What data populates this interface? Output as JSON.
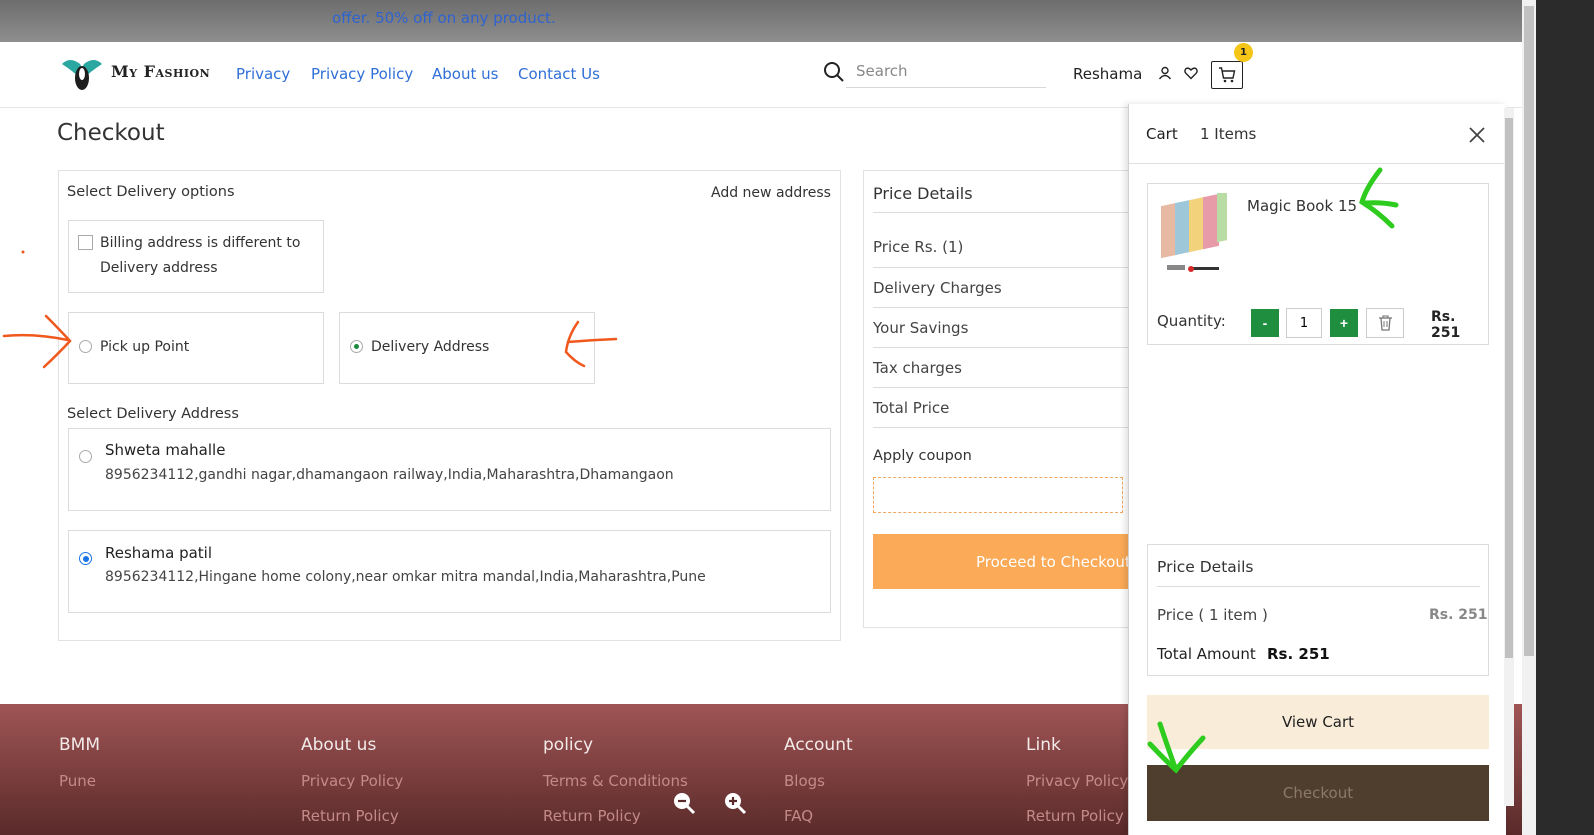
{
  "banner": {
    "text": "offer. 50% off on any product."
  },
  "header": {
    "brand": "My Fashion",
    "nav": [
      "Privacy",
      "Privacy Policy",
      "About us",
      "Contact Us"
    ],
    "search_placeholder": "Search",
    "username": "Reshama",
    "cart_count": "1"
  },
  "checkout": {
    "title": "Checkout",
    "select_delivery_options": "Select Delivery options",
    "add_new_address": "Add new address",
    "billing_line1": "Billing address is different to",
    "billing_line2": "Delivery address",
    "pickup_point": "Pick up Point",
    "delivery_address": "Delivery Address",
    "select_delivery_address": "Select Delivery Address",
    "addresses": [
      {
        "name": "Shweta mahalle",
        "detail": "8956234112,gandhi nagar,dhamangaon railway,India,Maharashtra,Dhamangaon"
      },
      {
        "name": "Reshama patil",
        "detail": "8956234112,Hingane home colony,near omkar mitra mandal,India,Maharashtra,Pune"
      }
    ]
  },
  "price_details": {
    "title": "Price Details",
    "rows": [
      "Price Rs. (1)",
      "Delivery Charges",
      "Your Savings",
      "Tax charges",
      "Total Price"
    ],
    "apply_coupon": "Apply coupon",
    "proceed_button": "Proceed to Checkout"
  },
  "footer": {
    "columns": [
      {
        "title": "BMM",
        "links": [
          "Pune"
        ]
      },
      {
        "title": "About us",
        "links": [
          "Privacy Policy",
          "Return Policy"
        ]
      },
      {
        "title": "policy",
        "links": [
          "Terms & Conditions",
          "Return Policy"
        ]
      },
      {
        "title": "Account",
        "links": [
          "Blogs",
          "FAQ"
        ]
      },
      {
        "title": "Link",
        "links": [
          "Privacy Policy",
          "Return Policy"
        ]
      }
    ]
  },
  "cart": {
    "title": "Cart",
    "items_count": "1 Items",
    "item_name": "Magic Book 15",
    "quantity_label": "Quantity:",
    "quantity_value": "1",
    "minus": "-",
    "plus": "+",
    "item_price": "Rs. 251",
    "price_title": "Price Details",
    "price_label": "Price ( 1 item )",
    "price_value": "Rs. 251",
    "total_label": "Total Amount",
    "total_value": "Rs. 251",
    "view_cart": "View Cart",
    "checkout": "Checkout"
  },
  "colors": {
    "accent_blue": "#2f6fd6",
    "green": "#1f8f3f",
    "orange": "#fbaa57",
    "footer": "#a05555",
    "annotation_orange": "#f0581e",
    "annotation_green": "#2ecc1e"
  },
  "icons": [
    "search-icon",
    "user-icon",
    "heart-icon",
    "cart-icon",
    "close-icon",
    "trash-icon",
    "zoom-out-icon",
    "zoom-in-icon"
  ]
}
